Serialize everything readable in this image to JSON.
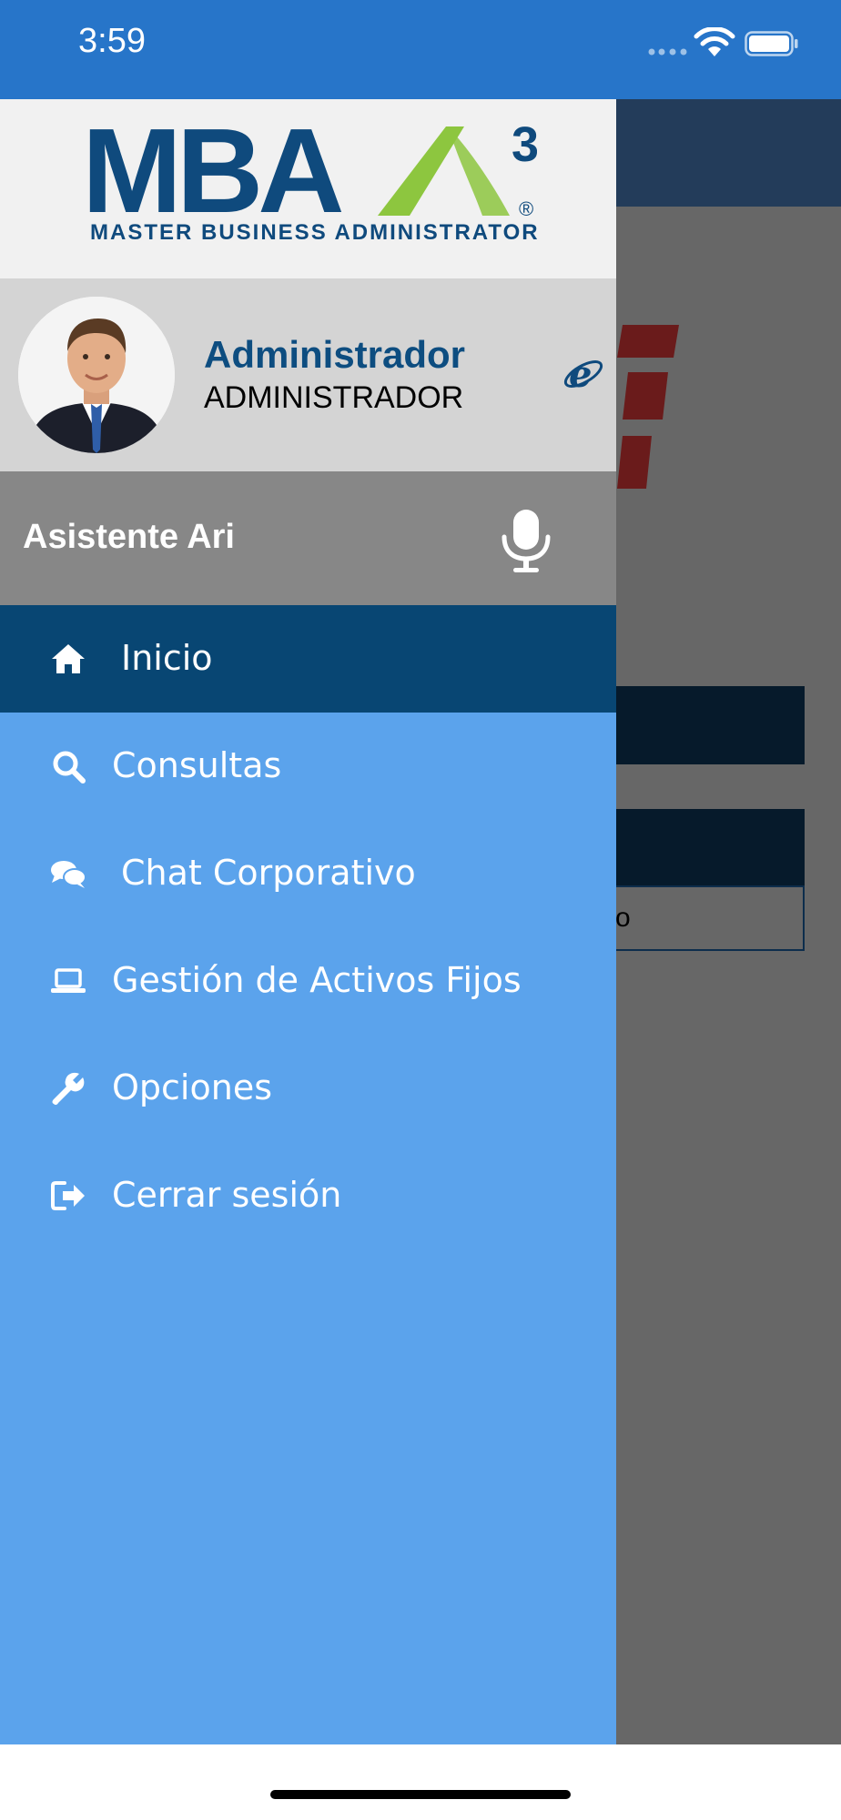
{
  "status_bar": {
    "time": "3:59"
  },
  "drawer": {
    "logo": {
      "letters": "MBA",
      "superscript": "3",
      "registered": "®",
      "subtitle": "MASTER BUSINESS ADMINISTRATOR"
    },
    "profile": {
      "name": "Administrador",
      "role": "ADMINISTRADOR"
    },
    "assistant": {
      "label": "Asistente Ari"
    },
    "menu": [
      {
        "label": "Inicio",
        "icon": "home-icon",
        "active": true
      },
      {
        "label": "Consultas",
        "icon": "search-icon",
        "active": false
      },
      {
        "label": "Chat Corporativo",
        "icon": "chat-icon",
        "active": false
      },
      {
        "label": "Gestión de Activos Fijos",
        "icon": "laptop-icon",
        "active": false
      },
      {
        "label": "Opciones",
        "icon": "wrench-icon",
        "active": false
      },
      {
        "label": "Cerrar sesión",
        "icon": "sign-out-icon",
        "active": false
      }
    ]
  },
  "background_app": {
    "input_fragment": "o"
  },
  "colors": {
    "status_bar": "#2775c9",
    "drawer_bg": "#5ba3ec",
    "active_item": "#084673",
    "logo_blue": "#0f4a7d",
    "logo_green": "#8dc63f"
  }
}
